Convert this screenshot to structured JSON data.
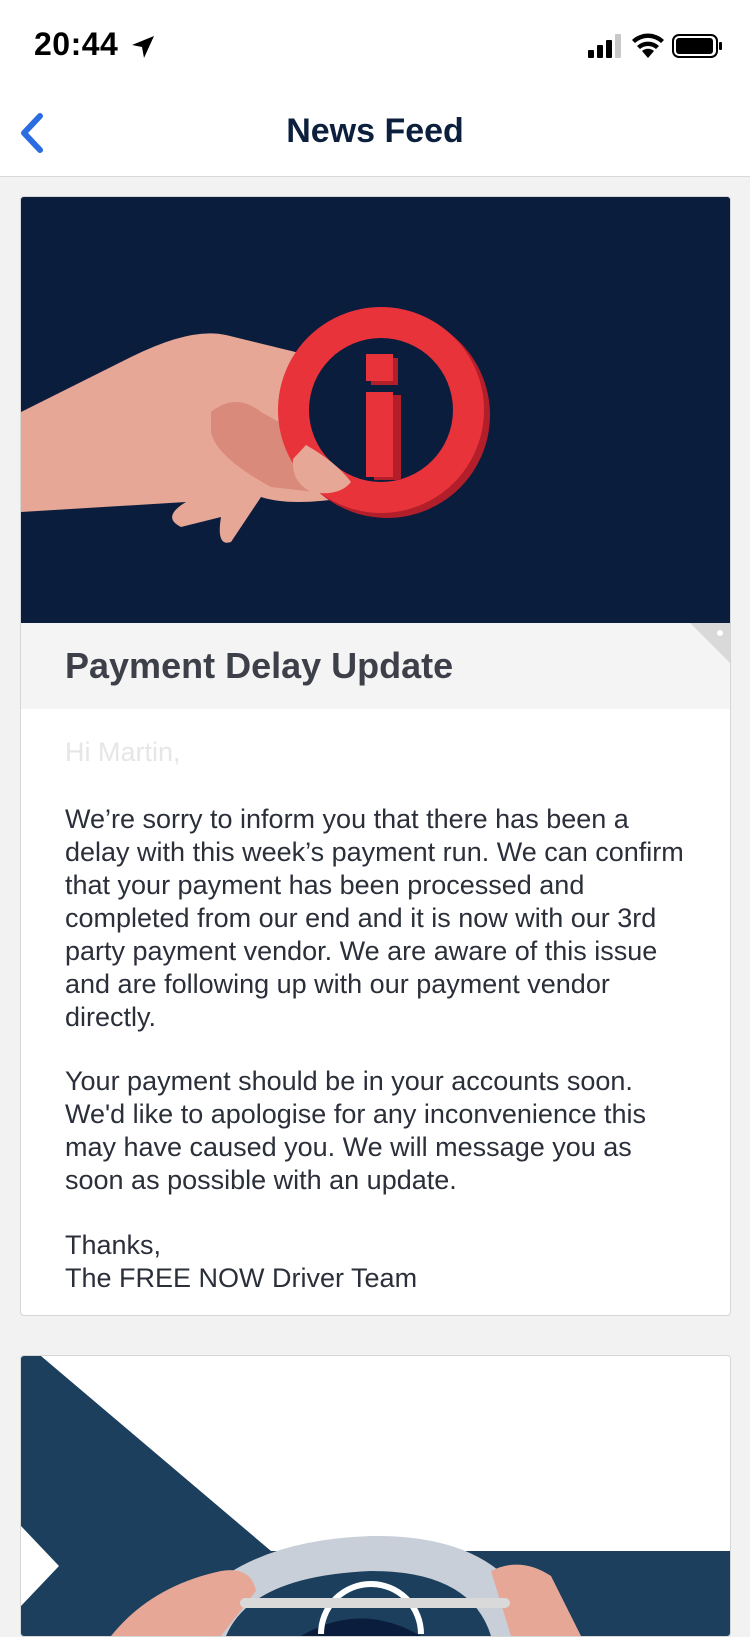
{
  "status_bar": {
    "time": "20:44",
    "icons": [
      "location-arrow-icon",
      "cellular-signal-icon",
      "wifi-icon",
      "battery-icon"
    ]
  },
  "nav": {
    "back_icon": "chevron-left-icon",
    "title": "News Feed",
    "accent_color": "#2b6de0"
  },
  "articles": [
    {
      "hero_illustration": "hand-holding-info-icon",
      "title": "Payment Delay Update",
      "greeting": "Hi Martin,",
      "paragraphs": [
        "We’re sorry to inform you that there has been a delay with this week’s payment run. We can confirm that your payment has been processed and completed from our end and it is now with our 3rd party payment vendor. We are aware of this issue and are following up with our payment vendor directly.",
        "Your payment should be in your accounts soon. We'd like to apologise for any inconvenience this may have caused you. We will message you as soon as possible with an update.",
        "Thanks,\nThe FREE NOW Driver Team"
      ]
    },
    {
      "hero_illustration": "hands-on-steering-wheel-icon"
    }
  ],
  "colors": {
    "hero_background": "#0b1d3c",
    "info_red": "#e8333a",
    "title_navy": "#0c1f3d"
  }
}
